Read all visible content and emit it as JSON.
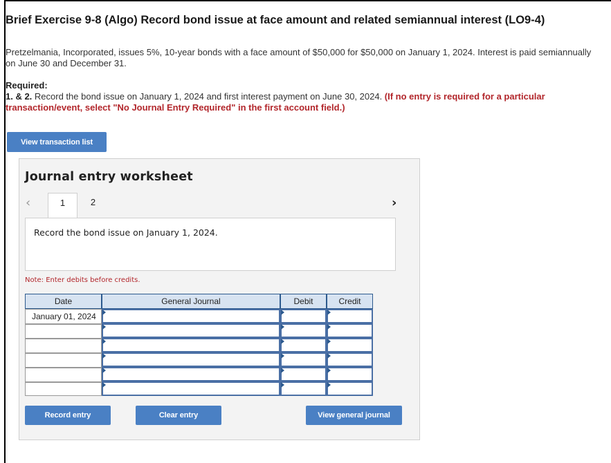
{
  "header": {
    "title": "Brief Exercise 9-8 (Algo) Record bond issue at face amount and related semiannual interest (LO9-4)"
  },
  "problem": {
    "intro": "Pretzelmania, Incorporated, issues 5%, 10-year bonds with a face amount of $50,000 for $50,000 on January 1, 2024. Interest is paid semiannually on June 30 and December 31.",
    "required_label": "Required:",
    "required_number": "1. & 2.",
    "required_text": " Record the bond issue on January 1, 2024 and first interest payment on June 30, 2024. ",
    "required_instruction": "(If no entry is required for a particular transaction/event, select \"No Journal Entry Required\" in the first account field.)"
  },
  "buttons": {
    "view_transaction_list": "View transaction list",
    "record_entry": "Record entry",
    "clear_entry": "Clear entry",
    "view_general_journal": "View general journal"
  },
  "worksheet": {
    "title": "Journal entry worksheet",
    "prev_icon": "‹",
    "next_icon": "›",
    "tabs": [
      "1",
      "2"
    ],
    "active_tab": "1",
    "instruction": "Record the bond issue on January 1, 2024.",
    "note": "Note: Enter debits before credits.",
    "columns": [
      "Date",
      "General Journal",
      "Debit",
      "Credit"
    ],
    "rows": [
      {
        "date": "January 01, 2024",
        "account": "",
        "debit": "",
        "credit": ""
      },
      {
        "date": "",
        "account": "",
        "debit": "",
        "credit": ""
      },
      {
        "date": "",
        "account": "",
        "debit": "",
        "credit": ""
      },
      {
        "date": "",
        "account": "",
        "debit": "",
        "credit": ""
      },
      {
        "date": "",
        "account": "",
        "debit": "",
        "credit": ""
      },
      {
        "date": "",
        "account": "",
        "debit": "",
        "credit": ""
      }
    ]
  },
  "colors": {
    "button_blue": "#4a80c4",
    "red_text": "#b2262b",
    "header_fill": "#d7e3f1",
    "input_border": "#4a6fa5"
  }
}
